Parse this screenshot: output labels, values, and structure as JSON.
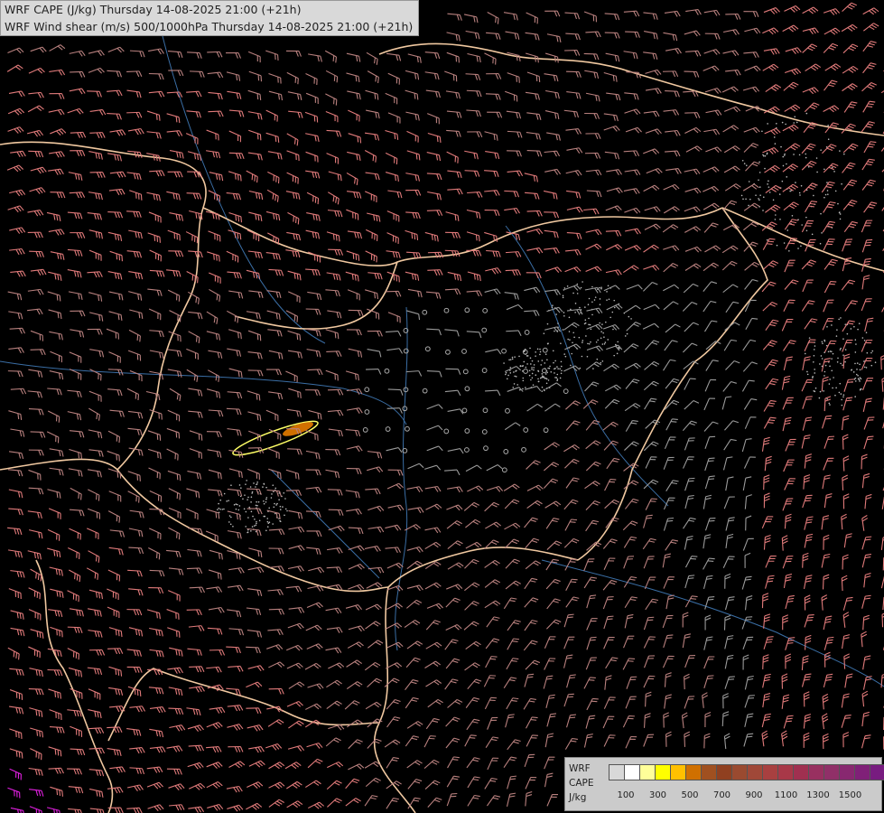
{
  "header": {
    "title_line1": "WRF CAPE (J/kg) Thursday 14-08-2025 21:00 (+21h)",
    "title_line2": "WRF Wind shear (m/s) 500/1000hPa Thursday 14-08-2025 21:00 (+21h)"
  },
  "legend": {
    "label_line1": "WRF",
    "label_line2": "CAPE",
    "label_line3": "J/kg",
    "colors": [
      "#d8d8d8",
      "#ffffff",
      "#ffff99",
      "#ffff00",
      "#ffc000",
      "#d07000",
      "#a05020",
      "#904020",
      "#9a4a30",
      "#a04838",
      "#a84040",
      "#a83848",
      "#a03050",
      "#983060",
      "#903068",
      "#882870",
      "#802078",
      "#781c80"
    ],
    "tick_labels": [
      "100",
      "300",
      "500",
      "700",
      "900",
      "1100",
      "1300",
      "1500"
    ]
  },
  "colors": {
    "background": "#000000",
    "border": "#f0c8a0",
    "river": "#3a6ea5",
    "barb_high": "#e07a7a",
    "barb_low": "#9a9a9a",
    "barb_strong": "#e020e0"
  },
  "icons": [
    "wind-barb-icon",
    "calm-circle-icon"
  ]
}
